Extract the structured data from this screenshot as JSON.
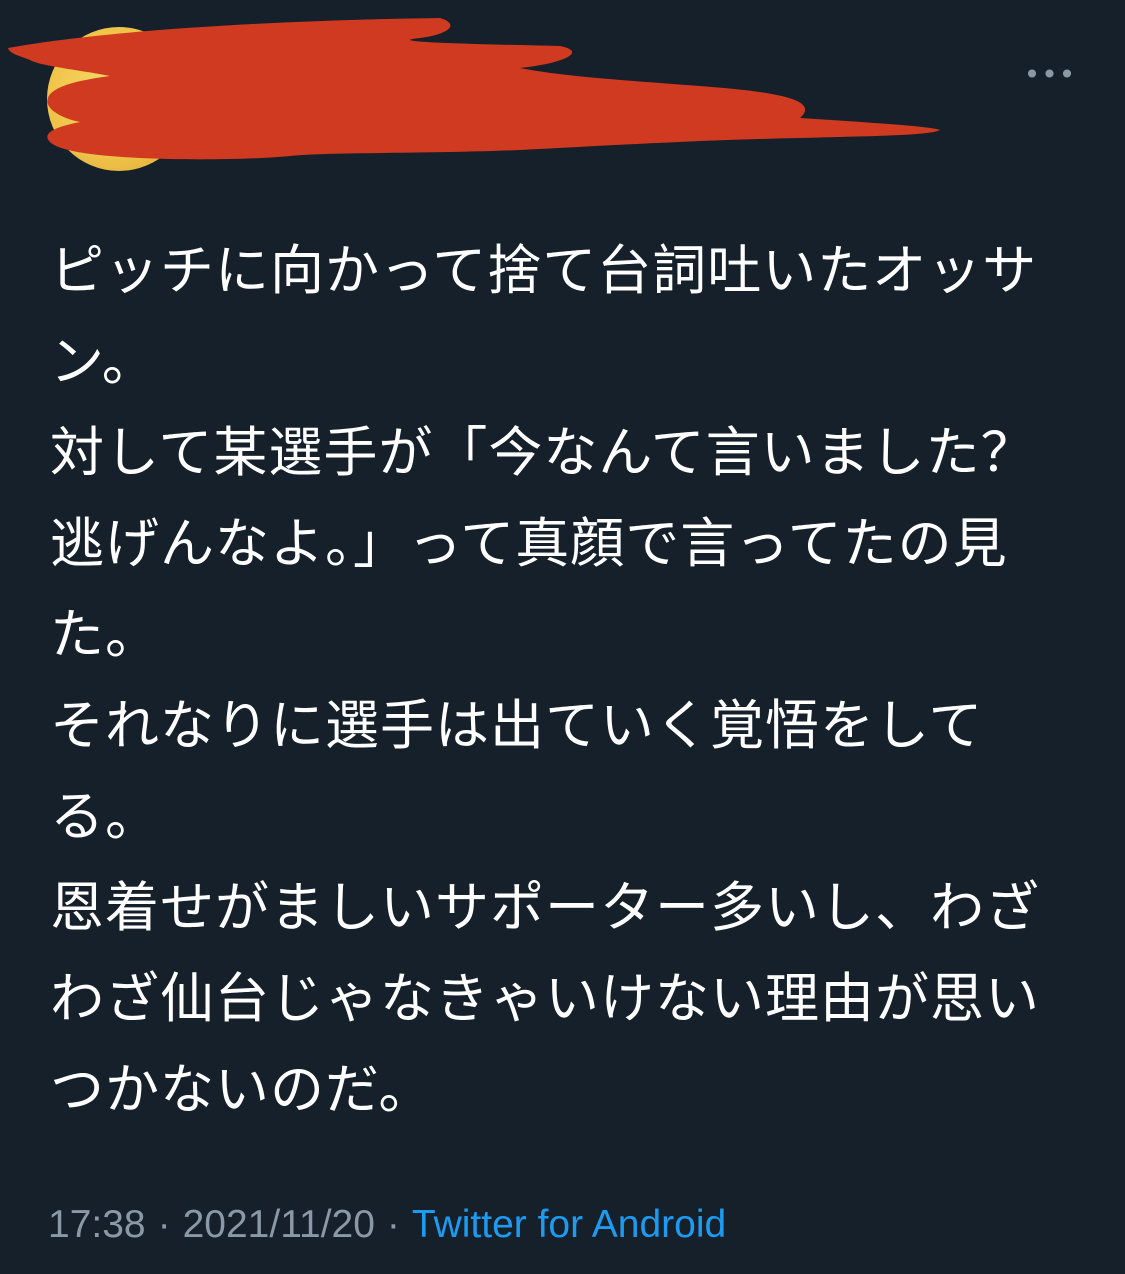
{
  "tweet": {
    "more_icon": "more-horizontal-icon",
    "more_label": "•••",
    "text": "ピッチに向かって捨て台詞吐いたオッサン。\n対して某選手が「今なんて言いました？逃げんなよ。」って真顔で言ってたの見た。\nそれなりに選手は出ていく覚悟をしてる。\n恩着せがましいサポーター多いし、わざわざ仙台じゃなきゃいけない理由が思いつかないのだ。",
    "time": "17:38",
    "separator": "·",
    "date": "2021/11/20",
    "source": "Twitter for Android"
  },
  "colors": {
    "background": "#15202b",
    "text": "#ffffff",
    "meta": "#8b98a5",
    "link": "#1d9bf0",
    "redaction": "#cf3a20",
    "avatar": "#f0c44a"
  }
}
